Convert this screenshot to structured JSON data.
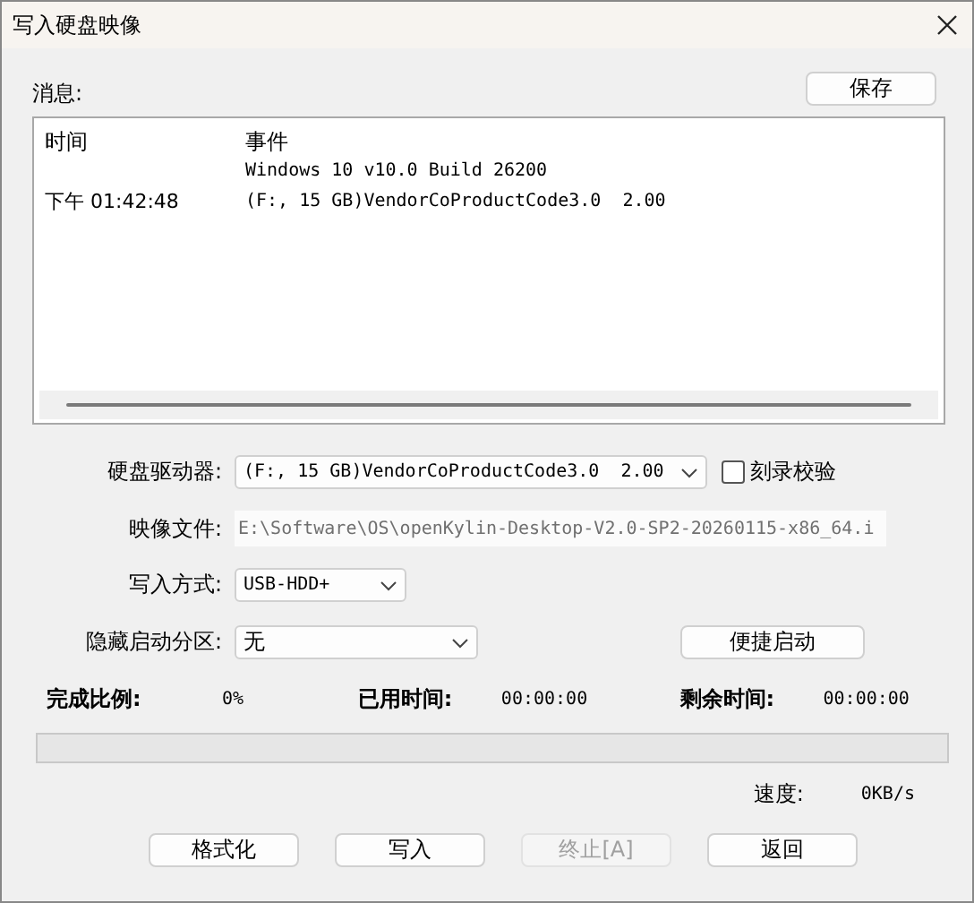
{
  "window": {
    "title": "写入硬盘映像"
  },
  "messages": {
    "label": "消息:",
    "save_button": "保存",
    "columns": [
      "时间",
      "事件"
    ],
    "rows": [
      {
        "event": "Windows 10 v10.0 Build 26200"
      },
      {
        "time": "下午 01:42:48",
        "event": "(F:, 15 GB)VendorCoProductCode3.0  2.00"
      }
    ]
  },
  "drive": {
    "label": "硬盘驱动器:",
    "value": "(F:, 15 GB)VendorCoProductCode3.0  2.00",
    "verify": {
      "label": "刻录校验",
      "checked": false
    }
  },
  "image_file": {
    "label": "映像文件:",
    "value": "E:\\Software\\OS\\openKylin-Desktop-V2.0-SP2-20260115-x86_64.i"
  },
  "write_mode": {
    "label": "写入方式:",
    "value": "USB-HDD+"
  },
  "hidden_partition": {
    "label": "隐藏启动分区:",
    "value": "无",
    "button": "便捷启动"
  },
  "stats": [
    {
      "label": "完成比例:",
      "value": "0%"
    },
    {
      "label": "已用时间:",
      "value": "00:00:00"
    },
    {
      "label": "剩余时间:",
      "value": "00:00:00"
    }
  ],
  "progress": {
    "level": 0
  },
  "speed": {
    "label": "速度:",
    "value": "0KB/s"
  },
  "buttons": [
    {
      "label": "格式化",
      "disabled": false
    },
    {
      "label": "写入",
      "disabled": false
    },
    {
      "label": "终止[A]",
      "disabled": true
    },
    {
      "label": "返回",
      "disabled": false
    }
  ]
}
